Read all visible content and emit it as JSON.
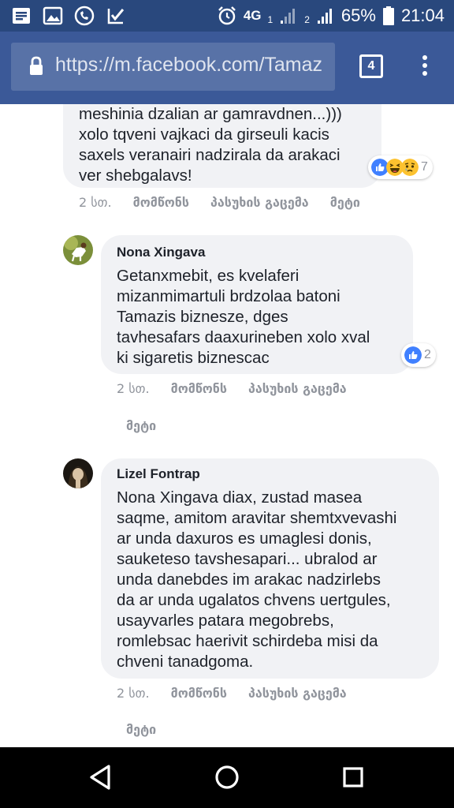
{
  "status_bar": {
    "network": "4G",
    "sim1": "1",
    "sim2": "2",
    "battery": "65%",
    "time": "21:04"
  },
  "browser": {
    "url": "https://m.facebook.com/Tamaz",
    "tab_count": "4"
  },
  "comments": [
    {
      "name": "",
      "text_lines": [
        "meshinia dzalian ar gamravdnen...)))",
        "xolo tqveni vajkaci da girseuli kacis",
        "saxels veranairi nadzirala da arakaci",
        "ver shebgalavs!"
      ],
      "reactions": [
        "like",
        "haha",
        "sad"
      ],
      "reaction_count": "7",
      "time": "2 სთ.",
      "like": "მომწონს",
      "reply": "პასუხის გაცემა",
      "more": "მეტი"
    },
    {
      "name": "Nona Xingava",
      "text_lines": [
        "Getanxmebit, es kvelaferi",
        "mizanmimartuli brdzolaa batoni",
        "Tamazis biznesze, dges",
        "tavhesafars daaxurineben xolo xval",
        "ki sigaretis biznescac"
      ],
      "reactions": [
        "like"
      ],
      "reaction_count": "2",
      "time": "2 სთ.",
      "like": "მომწონს",
      "reply": "პასუხის გაცემა",
      "more": "მეტი"
    },
    {
      "name": "Lizel Fontrap",
      "text_lines": [
        "Nona Xingava diax, zustad masea",
        "saqme, amitom aravitar shemtxvevashi",
        "ar unda daxuros es umaglesi donis,",
        "sauketeso tavshesapari... ubralod ar",
        "unda danebdes im arakac nadzirlebs",
        "da ar unda ugalatos chvens uertgules,",
        "usayvarles patara megobrebs,",
        "romlebsac haerivit schirdeba misi da",
        "chveni tanadgoma."
      ],
      "time": "2 სთ.",
      "like": "მომწონს",
      "reply": "პასუხის გაცემა",
      "more": "მეტი"
    }
  ],
  "colors": {
    "status_bar": "#29487d",
    "url_bar": "#3b5998",
    "bubble": "#f1f2f5",
    "like_blue": "#4080ff"
  }
}
